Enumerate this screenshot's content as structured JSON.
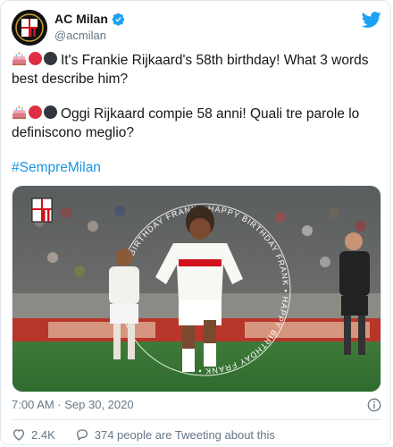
{
  "account": {
    "display_name": "AC Milan",
    "handle": "@acmilan"
  },
  "tweet": {
    "line_en": "It's Frankie Rijkaard's 58th birthday! What 3 words best describe him?",
    "line_it": "Oggi Rijkaard compie 58 anni! Quali tre parole lo definiscono meglio?",
    "hashtag": "#SempreMilan",
    "media_ring_text": "HAPPY BIRTHDAY FRANK • HAPPY BIRTHDAY FRANK • HAPPY BIRTHDAY FRANK • "
  },
  "meta": {
    "timestamp": "7:00 AM · Sep 30, 2020"
  },
  "actions": {
    "likes": "2.4K",
    "tweeting": "374 people are Tweeting about this"
  },
  "colors": {
    "link": "#1b95e0",
    "secondary_text": "#657786",
    "milan_red": "#d0111b",
    "twitter_blue": "#1da1f2"
  },
  "icons": [
    "verified-badge-icon",
    "twitter-bird-icon",
    "birthday-cake-icon",
    "red-circle-icon",
    "black-circle-icon",
    "info-icon",
    "heart-icon",
    "speech-bubble-icon"
  ]
}
